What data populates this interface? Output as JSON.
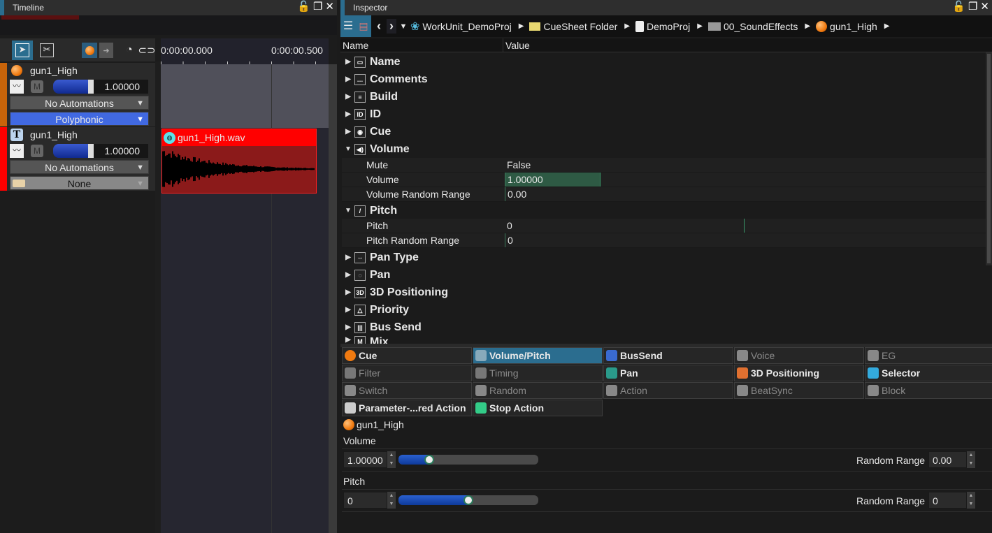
{
  "timeline": {
    "title": "Timeline",
    "toolbar": [
      {
        "icon": "select-arrow-icon"
      },
      {
        "icon": "scissors-icon"
      },
      {
        "icon": "record-icon"
      },
      {
        "icon": "goto-icon"
      },
      {
        "icon": "clock-icon"
      },
      {
        "icon": "link-icon"
      }
    ],
    "ruler": [
      "0:00:00.000",
      "0:00:00.500"
    ],
    "tracks": [
      {
        "name": "gun1_High",
        "icon": "cue-icon",
        "color": "#c8640a",
        "volume": "1.00000",
        "mute": "M",
        "volume_fill": 0.75,
        "automation": "No Automations",
        "mode": "Polyphonic"
      },
      {
        "name": "gun1_High",
        "icon": "track-icon",
        "color": "#ff0000",
        "volume": "1.00000",
        "mute": "M",
        "volume_fill": 0.75,
        "automation": "No Automations",
        "mode": "None"
      }
    ],
    "clip": {
      "name": "gun1_High.wav",
      "color": "#ff0000"
    }
  },
  "inspector": {
    "title": "Inspector",
    "breadcrumb": [
      "WorkUnit_DemoProj",
      "CueSheet Folder",
      "DemoProj",
      "00_SoundEffects",
      "gun1_High"
    ],
    "columns": [
      "Name",
      "Value"
    ],
    "categories": {
      "name": "Name",
      "comments": "Comments",
      "build": "Build",
      "id": "ID",
      "cue": "Cue",
      "volume": "Volume",
      "pitch": "Pitch",
      "pan_type": "Pan Type",
      "pan": "Pan",
      "positioning": "3D Positioning",
      "priority": "Priority",
      "bus_send": "Bus Send",
      "mix": "Mix"
    },
    "volume_props": [
      {
        "name": "Mute",
        "value": "False"
      },
      {
        "name": "Volume",
        "value": "1.00000"
      },
      {
        "name": "Volume Random Range",
        "value": "0.00"
      }
    ],
    "pitch_props": [
      {
        "name": "Pitch",
        "value": "0"
      },
      {
        "name": "Pitch Random Range",
        "value": "0"
      }
    ],
    "tabs": [
      {
        "label": "Cue",
        "state": "normal"
      },
      {
        "label": "Volume/Pitch",
        "state": "selected"
      },
      {
        "label": "BusSend",
        "state": "normal"
      },
      {
        "label": "Voice",
        "state": "disabled"
      },
      {
        "label": "EG",
        "state": "disabled"
      },
      {
        "label": "Filter",
        "state": "disabled"
      },
      {
        "label": "Timing",
        "state": "disabled"
      },
      {
        "label": "Pan",
        "state": "normal"
      },
      {
        "label": "3D Positioning",
        "state": "normal"
      },
      {
        "label": "Selector",
        "state": "normal"
      },
      {
        "label": "Switch",
        "state": "disabled"
      },
      {
        "label": "Random",
        "state": "disabled"
      },
      {
        "label": "Action",
        "state": "disabled"
      },
      {
        "label": "BeatSync",
        "state": "disabled"
      },
      {
        "label": "Block",
        "state": "disabled"
      },
      {
        "label": "Parameter-...red Action",
        "state": "normal"
      },
      {
        "label": "Stop Action",
        "state": "normal"
      }
    ],
    "panel": {
      "object": "gun1_High",
      "volume_label": "Volume",
      "volume_value": "1.00000",
      "volume_slider": 0.22,
      "volume_random_label": "Random Range",
      "volume_random": "0.00",
      "pitch_label": "Pitch",
      "pitch_value": "0",
      "pitch_slider": 0.5,
      "pitch_random_label": "Random Range",
      "pitch_random": "0"
    }
  }
}
